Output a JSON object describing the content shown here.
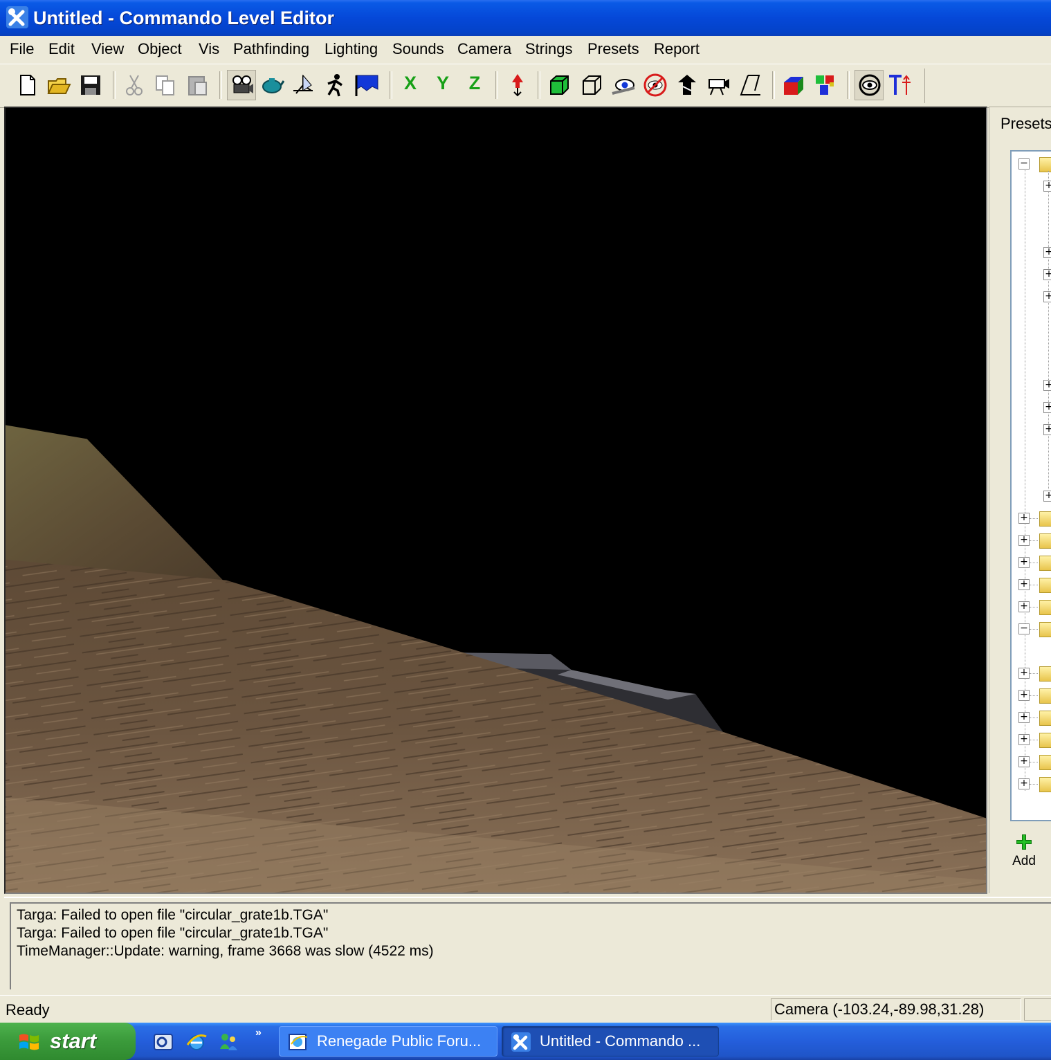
{
  "window": {
    "title": "Untitled - Commando Level Editor",
    "icon": "tools-icon"
  },
  "menu": {
    "items": [
      "File",
      "Edit",
      "View",
      "Object",
      "Vis",
      "Pathfinding",
      "Lighting",
      "Sounds",
      "Camera",
      "Strings",
      "Presets",
      "Report"
    ]
  },
  "toolbar": {
    "axis_x": "X",
    "axis_y": "Y",
    "axis_z": "Z",
    "buttons": [
      "new-icon",
      "open-icon",
      "save-icon",
      "cut-icon",
      "copy-icon",
      "paste-icon",
      "camera-mode-icon",
      "object-mode-icon",
      "fly-mode-icon",
      "walk-mode-icon",
      "flag-icon",
      "drop-icon",
      "box-icon",
      "wireframe-box-icon",
      "eye-icon",
      "vis-icon",
      "waypoint-icon",
      "camera-icon",
      "angle-icon",
      "color-cube-icon",
      "palette-icon",
      "view-icon",
      "text-icon"
    ]
  },
  "presets": {
    "title": "Presets",
    "add_label": "Add"
  },
  "output": {
    "lines": [
      "Targa: Failed to open file \"circular_grate1b.TGA\"",
      "Targa: Failed to open file \"circular_grate1b.TGA\"",
      "TimeManager::Update: warning, frame 3668 was slow (4522 ms)"
    ]
  },
  "status": {
    "text": "Ready",
    "camera": "Camera (-103.24,-89.98,31.28)"
  },
  "taskbar": {
    "start_label": "start",
    "quick_launch_chevron": "»",
    "tasks": [
      {
        "label": "Renegade Public Foru...",
        "icon": "browser-icon"
      },
      {
        "label": "Untitled - Commando ...",
        "icon": "tools-icon"
      }
    ]
  },
  "colors": {
    "title_bar": "#0548d8",
    "taskbar": "#245edb",
    "start_button": "#3c9c3c",
    "axis_labels": "#17a017",
    "window_bg": "#ece9d8"
  }
}
